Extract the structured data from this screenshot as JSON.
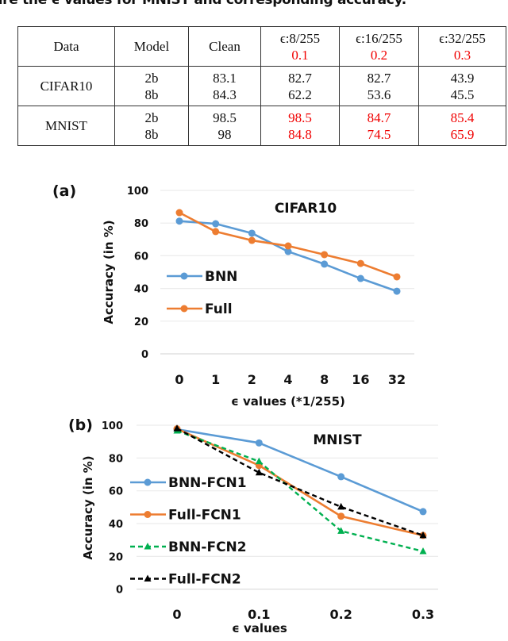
{
  "caption": "are the ϵ values for MNIST and corresponding accuracy.",
  "table": {
    "headers": [
      {
        "label": "Data"
      },
      {
        "label": "Model"
      },
      {
        "label": "Clean"
      },
      {
        "label": "ϵ:8/255",
        "sub": "0.1"
      },
      {
        "label": "ϵ:16/255",
        "sub": "0.2"
      },
      {
        "label": "ϵ:32/255",
        "sub": "0.3"
      }
    ],
    "rows": [
      {
        "data": "CIFAR10",
        "models": [
          "2b",
          "8b"
        ],
        "clean": [
          "83.1",
          "84.3"
        ],
        "eps8": [
          "82.7",
          "62.2"
        ],
        "eps16": [
          "82.7",
          "53.6"
        ],
        "eps32": [
          "43.9",
          "45.5"
        ],
        "highlight": false
      },
      {
        "data": "MNIST",
        "models": [
          "2b",
          "8b"
        ],
        "clean": [
          "98.5",
          "98"
        ],
        "eps8": [
          "98.5",
          "84.8"
        ],
        "eps16": [
          "84.7",
          "74.5"
        ],
        "eps32": [
          "85.4",
          "65.9"
        ],
        "highlight": true
      }
    ],
    "highlight_color": "#f00000"
  },
  "chart_data": [
    {
      "panel_label": "(a)",
      "type": "line",
      "title": "CIFAR10",
      "xlabel": "ϵ values (*1/255)",
      "ylabel": "Accuracy (in %)",
      "categories": [
        "0",
        "1",
        "2",
        "4",
        "8",
        "16",
        "32"
      ],
      "ylim": [
        0,
        100
      ],
      "yticks": [
        "0",
        "20",
        "40",
        "60",
        "80",
        "100"
      ],
      "grid": true,
      "legend": "center-left",
      "series": [
        {
          "name": "BNN",
          "color": "#5b9bd5",
          "dash": false,
          "marker": "circle",
          "values": [
            81.2,
            79.6,
            73.8,
            62.6,
            54.9,
            46.1,
            38.3
          ]
        },
        {
          "name": "Full",
          "color": "#ed7d31",
          "dash": false,
          "marker": "circle",
          "values": [
            86.4,
            74.8,
            69.4,
            66.0,
            60.7,
            55.3,
            47.1
          ]
        }
      ]
    },
    {
      "panel_label": "(b)",
      "type": "line",
      "title": "MNIST",
      "xlabel": "ϵ values",
      "ylabel": "Accuracy (in %)",
      "categories": [
        "0",
        "0.1",
        "0.2",
        "0.3"
      ],
      "ylim": [
        0,
        100
      ],
      "yticks": [
        "0",
        "20",
        "40",
        "60",
        "80",
        "100"
      ],
      "grid": true,
      "legend": "left",
      "series": [
        {
          "name": "BNN-FCN1",
          "color": "#5b9bd5",
          "dash": false,
          "marker": "circle",
          "values": [
            97.5,
            89.2,
            68.6,
            47.3
          ]
        },
        {
          "name": "Full-FCN1",
          "color": "#ed7d31",
          "dash": false,
          "marker": "circle",
          "values": [
            97.8,
            75.5,
            44.5,
            32.8
          ]
        },
        {
          "name": "BNN-FCN2",
          "color": "#00b050",
          "dash": true,
          "marker": "triangle",
          "values": [
            96.6,
            77.9,
            35.5,
            23.1
          ]
        },
        {
          "name": "Full-FCN2",
          "color": "#000000",
          "dash": true,
          "marker": "triangle",
          "values": [
            98.0,
            71.1,
            50.2,
            32.8
          ]
        }
      ]
    }
  ]
}
